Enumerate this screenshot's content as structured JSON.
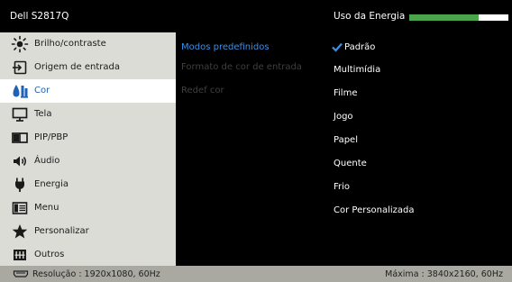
{
  "header": {
    "model": "Dell S2817Q",
    "energy_label": "Uso da Energia",
    "energy_level_fraction": 0.7,
    "energy_bar_color": "#4ba64b"
  },
  "nav": {
    "items": [
      {
        "label": "Brilho/contraste",
        "icon": "brightness-icon"
      },
      {
        "label": "Origem de entrada",
        "icon": "input-source-icon"
      },
      {
        "label": "Cor",
        "icon": "color-icon",
        "active": true
      },
      {
        "label": "Tela",
        "icon": "display-icon"
      },
      {
        "label": "PIP/PBP",
        "icon": "pip-icon"
      },
      {
        "label": "Áudio",
        "icon": "audio-icon"
      },
      {
        "label": "Energia",
        "icon": "power-icon"
      },
      {
        "label": "Menu",
        "icon": "menu-icon"
      },
      {
        "label": "Personalizar",
        "icon": "star-icon"
      },
      {
        "label": "Outros",
        "icon": "others-icon"
      }
    ],
    "active_color": "#1e63b8"
  },
  "submenu": {
    "items": [
      {
        "label": "Modos predefinidos",
        "state": "active"
      },
      {
        "label": "Formato de cor de entrada",
        "state": "disabled"
      },
      {
        "label": "Redef cor",
        "state": "disabled"
      }
    ]
  },
  "options": {
    "items": [
      {
        "label": "Padrão",
        "selected": true
      },
      {
        "label": "Multimídia"
      },
      {
        "label": "Filme"
      },
      {
        "label": "Jogo"
      },
      {
        "label": "Papel"
      },
      {
        "label": "Quente"
      },
      {
        "label": "Frio"
      },
      {
        "label": "Cor Personalizada"
      }
    ],
    "check_color": "#3f8fe0"
  },
  "footer": {
    "resolution": "Resolução : 1920x1080, 60Hz",
    "maximum": "Máxima : 3840x2160, 60Hz"
  }
}
